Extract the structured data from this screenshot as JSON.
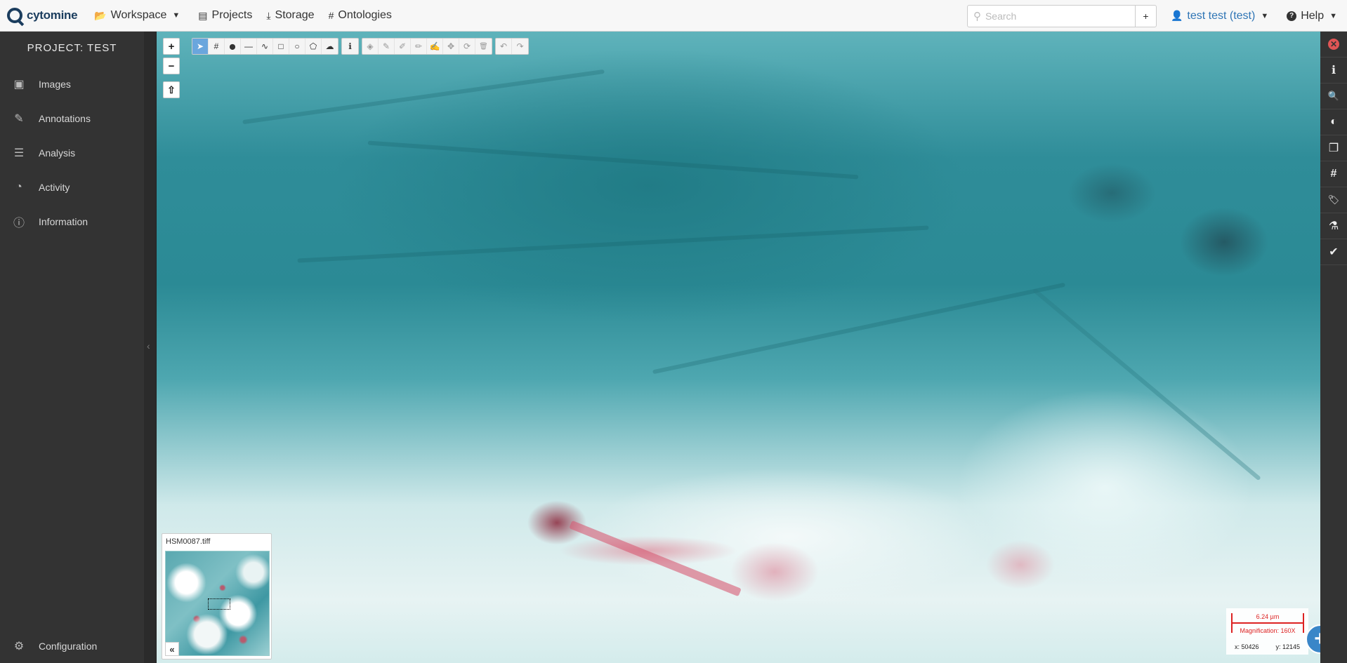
{
  "navbar": {
    "brand": "cytomine",
    "items": [
      {
        "label": "Workspace",
        "icon": "folder-open-icon",
        "has_caret": true
      },
      {
        "label": "Projects",
        "icon": "list-alt-icon",
        "has_caret": false
      },
      {
        "label": "Storage",
        "icon": "download-icon",
        "has_caret": false
      },
      {
        "label": "Ontologies",
        "icon": "hashtag-icon",
        "has_caret": false
      }
    ],
    "search": {
      "placeholder": "Search",
      "value": ""
    },
    "add_label": "+",
    "user_label": "test test (test)",
    "help_label": "Help"
  },
  "sidebar": {
    "project_title": "PROJECT: TEST",
    "items": [
      {
        "label": "Images",
        "icon": "images-icon"
      },
      {
        "label": "Annotations",
        "icon": "edit-icon"
      },
      {
        "label": "Analysis",
        "icon": "tasks-icon"
      },
      {
        "label": "Activity",
        "icon": "tachometer-icon"
      },
      {
        "label": "Information",
        "icon": "info-circle-icon"
      }
    ],
    "config_label": "Configuration"
  },
  "viewer": {
    "zoom_in": "+",
    "zoom_out": "−",
    "rotate": "⇧",
    "tools_group1": [
      {
        "name": "select-tool",
        "glyph": "➤",
        "active": true
      },
      {
        "name": "hashtag-tool",
        "glyph": "#",
        "active": false
      },
      {
        "name": "point-tool",
        "glyph": "⬤",
        "active": false
      },
      {
        "name": "line-tool",
        "glyph": "—",
        "active": false
      },
      {
        "name": "freehand-line-tool",
        "glyph": "∿",
        "active": false
      },
      {
        "name": "rectangle-tool",
        "glyph": "□",
        "active": false
      },
      {
        "name": "circle-tool",
        "glyph": "○",
        "active": false
      },
      {
        "name": "polygon-tool",
        "glyph": "⬠",
        "active": false
      },
      {
        "name": "freehand-polygon-tool",
        "glyph": "☁",
        "active": false
      }
    ],
    "tools_group2": [
      {
        "name": "info-tool",
        "glyph": "ℹ"
      }
    ],
    "tools_group3": [
      {
        "name": "fill-tool",
        "glyph": "◈"
      },
      {
        "name": "edit-tool",
        "glyph": "✎"
      },
      {
        "name": "correct-add-tool",
        "glyph": "✐"
      },
      {
        "name": "correct-remove-tool",
        "glyph": "✏"
      },
      {
        "name": "modify-tool",
        "glyph": "✍"
      },
      {
        "name": "move-tool",
        "glyph": "✥"
      },
      {
        "name": "rotate-tool",
        "glyph": "⟳"
      },
      {
        "name": "delete-tool",
        "glyph": "🗑"
      }
    ],
    "tools_group4": [
      {
        "name": "undo-tool",
        "glyph": "↶"
      },
      {
        "name": "redo-tool",
        "glyph": "↷"
      }
    ],
    "overview": {
      "filename": "HSM0087.tiff",
      "toggle": "«"
    },
    "scale": {
      "length": "6.24 µm",
      "magnification": "Magnification: 160X"
    },
    "coords": {
      "x": "x: 50426",
      "y": "y: 12145"
    },
    "fab": "+"
  },
  "right_panel": [
    {
      "name": "close-icon",
      "glyph": "✕"
    },
    {
      "name": "info-icon",
      "glyph": "ℹ"
    },
    {
      "name": "search-icon",
      "glyph": "🔍"
    },
    {
      "name": "contrast-icon",
      "glyph": "◐"
    },
    {
      "name": "copy-icon",
      "glyph": "❐"
    },
    {
      "name": "hashtag-icon",
      "glyph": "#"
    },
    {
      "name": "tag-icon",
      "glyph": "🏷"
    },
    {
      "name": "microscope-icon",
      "glyph": "⚗"
    },
    {
      "name": "check-circle-icon",
      "glyph": "✔"
    }
  ]
}
